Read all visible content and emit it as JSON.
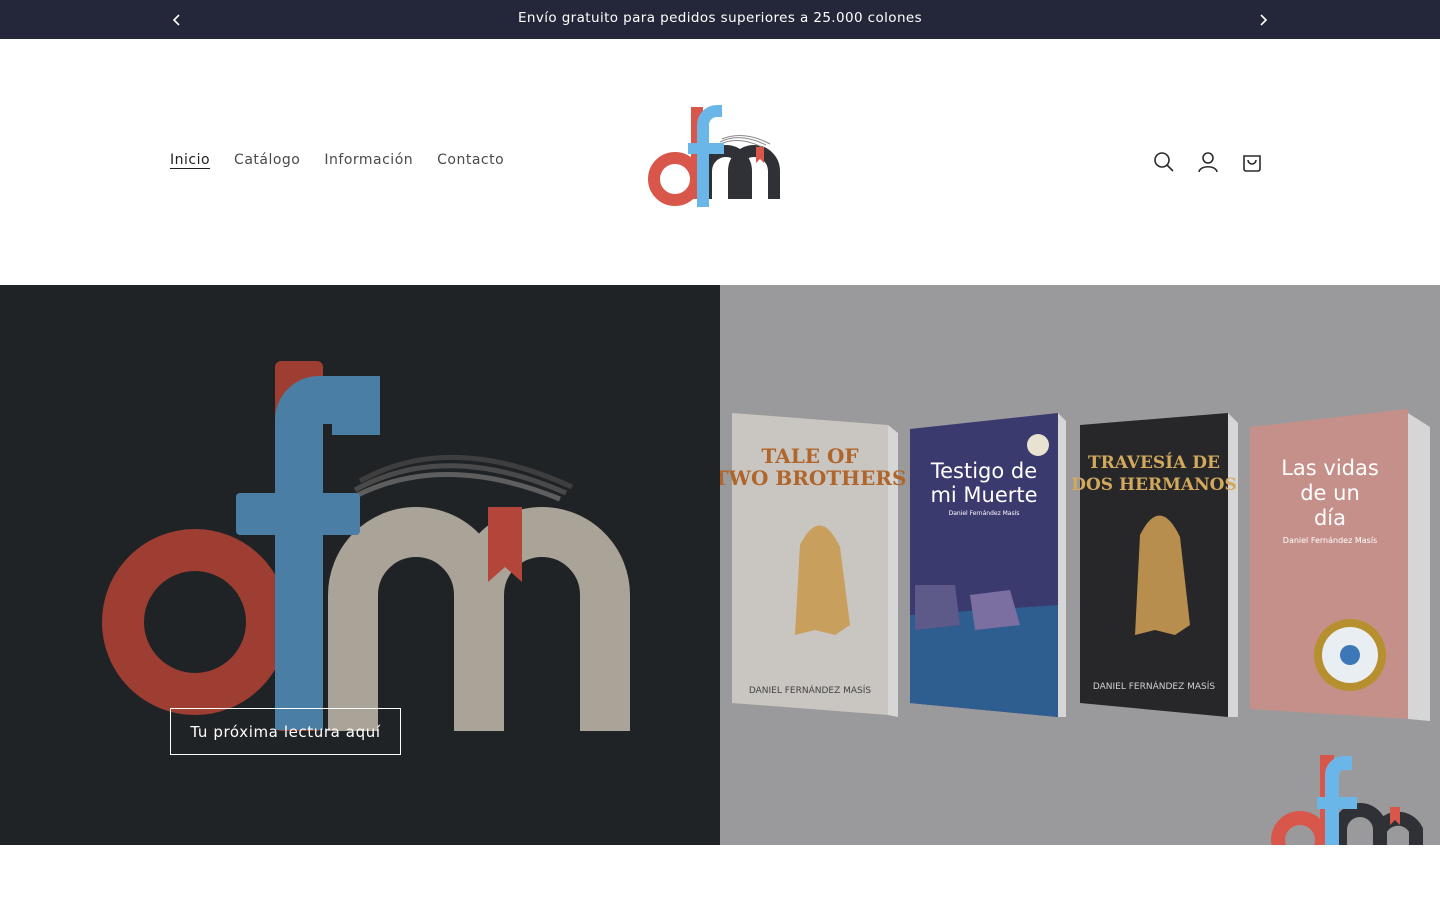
{
  "announcement": {
    "text": "Envío gratuito para pedidos superiores a 25.000 colones"
  },
  "nav": {
    "items": [
      {
        "label": "Inicio",
        "active": true
      },
      {
        "label": "Catálogo",
        "active": false
      },
      {
        "label": "Información",
        "active": false
      },
      {
        "label": "Contacto",
        "active": false
      }
    ]
  },
  "header_icons": [
    "search-icon",
    "account-icon",
    "cart-icon"
  ],
  "brand": {
    "colors": {
      "red": "#d9574a",
      "blue": "#6bb6e8",
      "dark": "#2f3136",
      "hero_blue": "#4b7ea4",
      "hero_red": "#9e3e32",
      "hero_beige": "#a9a398"
    }
  },
  "hero": {
    "cta_label": "Tu próxima lectura aquí",
    "books": [
      {
        "title_line1": "TALE OF",
        "title_line2": "TWO BROTHERS",
        "author": "DANIEL FERNÁNDEZ MASÍS"
      },
      {
        "title_line1": "Testigo de",
        "title_line2": "mi Muerte",
        "author": "Daniel Fernández Masís"
      },
      {
        "title_line1": "TRAVESÍA DE",
        "title_line2": "DOS HERMANOS",
        "author": "DANIEL FERNÁNDEZ MASÍS"
      },
      {
        "title_line1": "Las vidas",
        "title_line2": "de un",
        "title_line3": "día",
        "author": "Daniel Fernández Masís"
      }
    ]
  }
}
